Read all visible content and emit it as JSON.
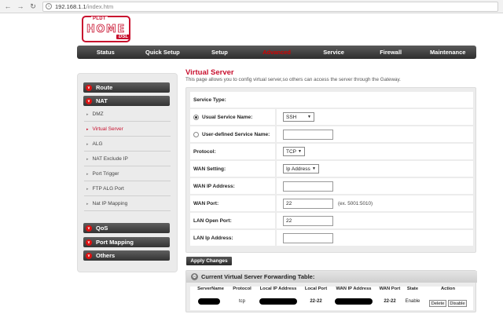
{
  "browser": {
    "url_host": "192.168.1.1",
    "url_path": "/index.htm",
    "back_glyph": "←",
    "forward_glyph": "→",
    "reload_glyph": "↻",
    "info_glyph": "i"
  },
  "logo": {
    "brand": "PLDT",
    "name": "HOME",
    "suffix": "DSL",
    "brand_color": "#c8102e"
  },
  "main_nav": {
    "items": [
      "Status",
      "Quick Setup",
      "Setup",
      "Advanced",
      "Service",
      "Firewall",
      "Maintenance"
    ],
    "active_index": 3,
    "active_color": "#d40000"
  },
  "sidebar": {
    "groups": [
      {
        "label": "Route",
        "icon": "chevron-down-icon"
      },
      {
        "label": "NAT",
        "icon": "chevron-down-icon"
      },
      {
        "label": "QoS",
        "icon": "chevron-down-icon"
      },
      {
        "label": "Port Mapping",
        "icon": "chevron-down-icon"
      },
      {
        "label": "Others",
        "icon": "chevron-down-icon"
      }
    ],
    "nat_items": [
      "DMZ",
      "Virtual Server",
      "ALG",
      "NAT Exclude IP",
      "Port Trigger",
      "FTP ALG Port",
      "Nat IP Mapping"
    ],
    "active_item": "Virtual Server",
    "bullet_glyph": "∨",
    "arrow_glyph": "▸"
  },
  "page": {
    "title": "Virtual Server",
    "description": "This page allows you to config virtual server,so others can access the server through the Gateway."
  },
  "form": {
    "service_type_label": "Service Type:",
    "usual_service_label": "Usual Service Name:",
    "usual_service_value": "SSH",
    "user_defined_label": "User-defined Service Name:",
    "user_defined_value": "",
    "protocol_label": "Protocol:",
    "protocol_value": "TCP",
    "wan_setting_label": "WAN Setting:",
    "wan_setting_value": "Ip Address",
    "wan_ip_label": "WAN IP Address:",
    "wan_ip_value": "",
    "wan_port_label": "WAN Port:",
    "wan_port_value": "22",
    "wan_port_hint": "(ex. 5001:5010)",
    "lan_open_port_label": "LAN Open Port:",
    "lan_open_port_value": "22",
    "lan_ip_label": "LAN Ip Address:",
    "lan_ip_value": "",
    "selected_radio": "usual",
    "caret_glyph": "▼"
  },
  "apply_button": "Apply Changes",
  "forwarding_table": {
    "title": "Current Virtual Server Forwarding Table:",
    "gear_glyph": "⚙",
    "columns": [
      "ServerName",
      "Protocol",
      "Local IP Address",
      "Local Port",
      "WAN IP Address",
      "WAN Port",
      "State",
      "Action"
    ],
    "rows": [
      {
        "server_name": "",
        "protocol": "tcp",
        "local_ip": "",
        "local_port": "22-22",
        "wan_ip": "",
        "wan_port": "22-22",
        "state": "Enable",
        "delete_label": "Delete",
        "disable_label": "Disable"
      }
    ]
  }
}
